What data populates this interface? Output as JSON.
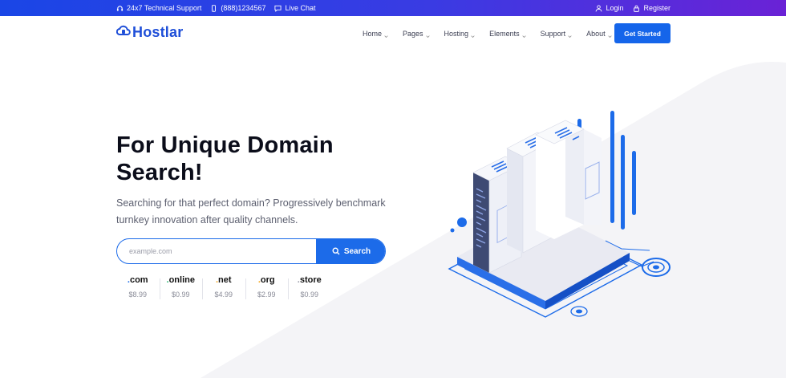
{
  "topbar": {
    "support": "24x7 Technical Support",
    "phone": "(888)1234567",
    "chat": "Live Chat",
    "login": "Login",
    "register": "Register"
  },
  "nav": {
    "logo": "Hostlar",
    "items": [
      {
        "label": "Home"
      },
      {
        "label": "Pages"
      },
      {
        "label": "Hosting"
      },
      {
        "label": "Elements"
      },
      {
        "label": "Support"
      },
      {
        "label": "About"
      }
    ],
    "cta": "Get Started"
  },
  "hero": {
    "title": "For Unique Domain Search!",
    "description": "Searching for that perfect domain? Progressively benchmark turnkey innovation after quality channels.",
    "search_placeholder": "example.com",
    "search_button": "Search"
  },
  "tlds": [
    {
      "name": ".com",
      "price": "$8.99",
      "accent": "#1c6be9"
    },
    {
      "name": ".online",
      "price": "$0.99",
      "accent": "#2bb673"
    },
    {
      "name": ".net",
      "price": "$4.99",
      "accent": "#f6a61a"
    },
    {
      "name": ".org",
      "price": "$2.99",
      "accent": "#f6a61a"
    },
    {
      "name": ".store",
      "price": "$0.99",
      "accent": "#9a9ca8"
    }
  ],
  "colors": {
    "primary": "#1c6be9",
    "gradient_start": "#1a46e6",
    "gradient_end": "#6a22d6"
  }
}
